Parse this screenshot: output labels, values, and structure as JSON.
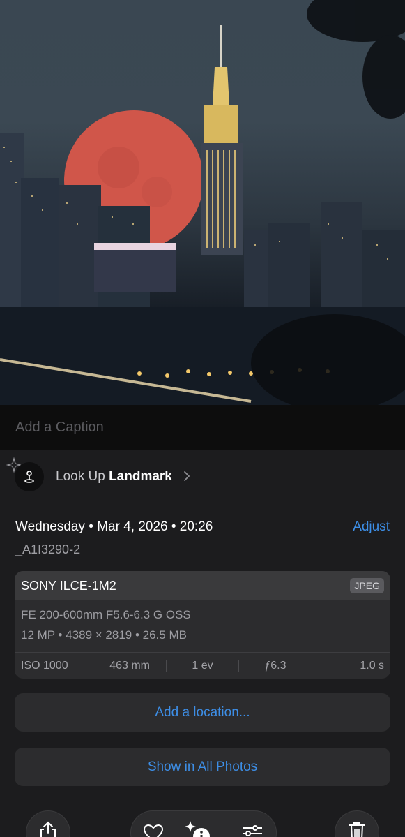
{
  "photo": {
    "alt_icon": "moonrise-photo"
  },
  "caption": {
    "placeholder": "Add a Caption"
  },
  "lookup": {
    "prefix": "Look Up",
    "subject": "Landmark"
  },
  "info": {
    "date": "Wednesday • Mar 4, 2026 • 20:26",
    "adjust_label": "Adjust",
    "filename": "_A1I3290-2"
  },
  "camera": {
    "model": "SONY ILCE-1M2",
    "format": "JPEG",
    "lens": "FE 200-600mm F5.6-6.3 G OSS",
    "specs": "12 MP • 4389 × 2819 • 26.5 MB",
    "iso": "ISO 1000",
    "focal": "463 mm",
    "ev": "1 ev",
    "aperture": "ƒ6.3",
    "shutter": "1.0 s"
  },
  "actions": {
    "add_location": "Add a location...",
    "show_all": "Show in All Photos"
  },
  "toolbar": {
    "icons": [
      "share-icon",
      "heart-icon",
      "info-sparkle-icon",
      "adjust-icon",
      "trash-icon"
    ]
  },
  "colors": {
    "accent": "#3d8ee6",
    "panel": "#1c1c1e",
    "card": "#2c2c2e"
  }
}
